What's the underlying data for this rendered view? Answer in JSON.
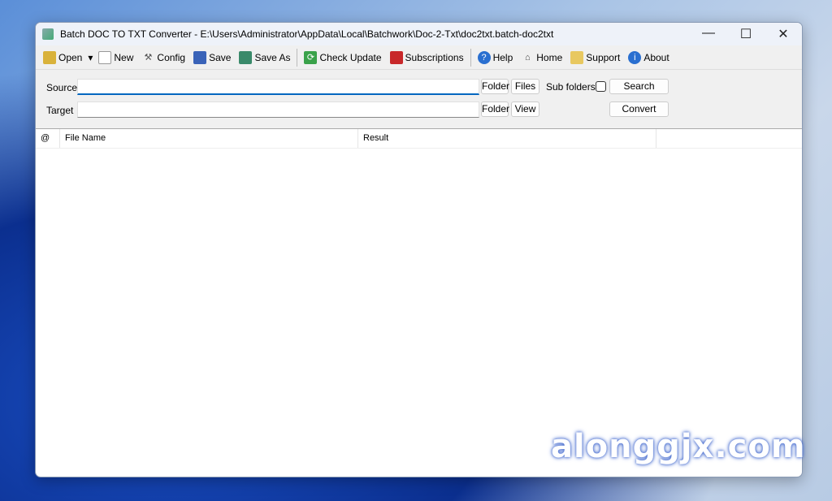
{
  "window": {
    "title": "Batch DOC TO TXT Converter - E:\\Users\\Administrator\\AppData\\Local\\Batchwork\\Doc-2-Txt\\doc2txt.batch-doc2txt",
    "minimize": "—",
    "maximize": "☐",
    "close": "✕"
  },
  "toolbar": {
    "open": "Open",
    "new": "New",
    "config": "Config",
    "save": "Save",
    "save_as": "Save As",
    "check_update": "Check Update",
    "subscriptions": "Subscriptions",
    "help": "Help",
    "home": "Home",
    "support": "Support",
    "about": "About"
  },
  "form": {
    "source_label": "Source",
    "source_value": "",
    "target_label": "Target",
    "target_value": "",
    "folder": "Folder",
    "files": "Files",
    "view": "View",
    "sub_folders": "Sub folders",
    "search": "Search",
    "convert": "Convert"
  },
  "table": {
    "columns": [
      "@",
      "File Name",
      "Result"
    ]
  },
  "watermark": "alonggjx.com"
}
